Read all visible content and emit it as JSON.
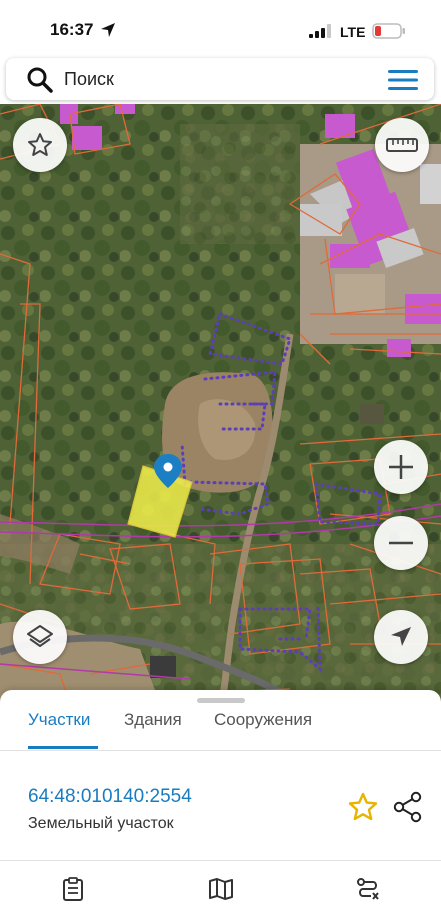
{
  "status_bar": {
    "time": "16:37",
    "network": "LTE",
    "icons": [
      "location-arrow-icon",
      "signal-icon",
      "battery-icon"
    ]
  },
  "search": {
    "placeholder": "Поиск",
    "icons": [
      "search-icon",
      "menu-icon"
    ]
  },
  "map": {
    "buttons": [
      "favorite-star-icon",
      "ruler-icon",
      "zoom-in-icon",
      "zoom-out-icon",
      "layers-icon",
      "locate-arrow-icon"
    ],
    "colors": {
      "parcel_selected": "#f2f04a",
      "parcel_border": "#e06a3a",
      "zone_border": "#5c3fb8",
      "building_roof": "#c85ad0",
      "marker": "#1c7fc4"
    }
  },
  "sheet": {
    "tabs": [
      {
        "label": "Участки",
        "active": true
      },
      {
        "label": "Здания",
        "active": false
      },
      {
        "label": "Сооружения",
        "active": false
      }
    ],
    "parcel": {
      "cadastral_number": "64:48:010140:2554",
      "type": "Земельный участок"
    },
    "actions": [
      "star-icon",
      "share-icon"
    ]
  },
  "bottom_nav": {
    "icons": [
      "clipboard-icon",
      "map-icon",
      "route-icon"
    ]
  },
  "colors": {
    "accent": "#1a7cc0",
    "star": "#e7b400"
  }
}
